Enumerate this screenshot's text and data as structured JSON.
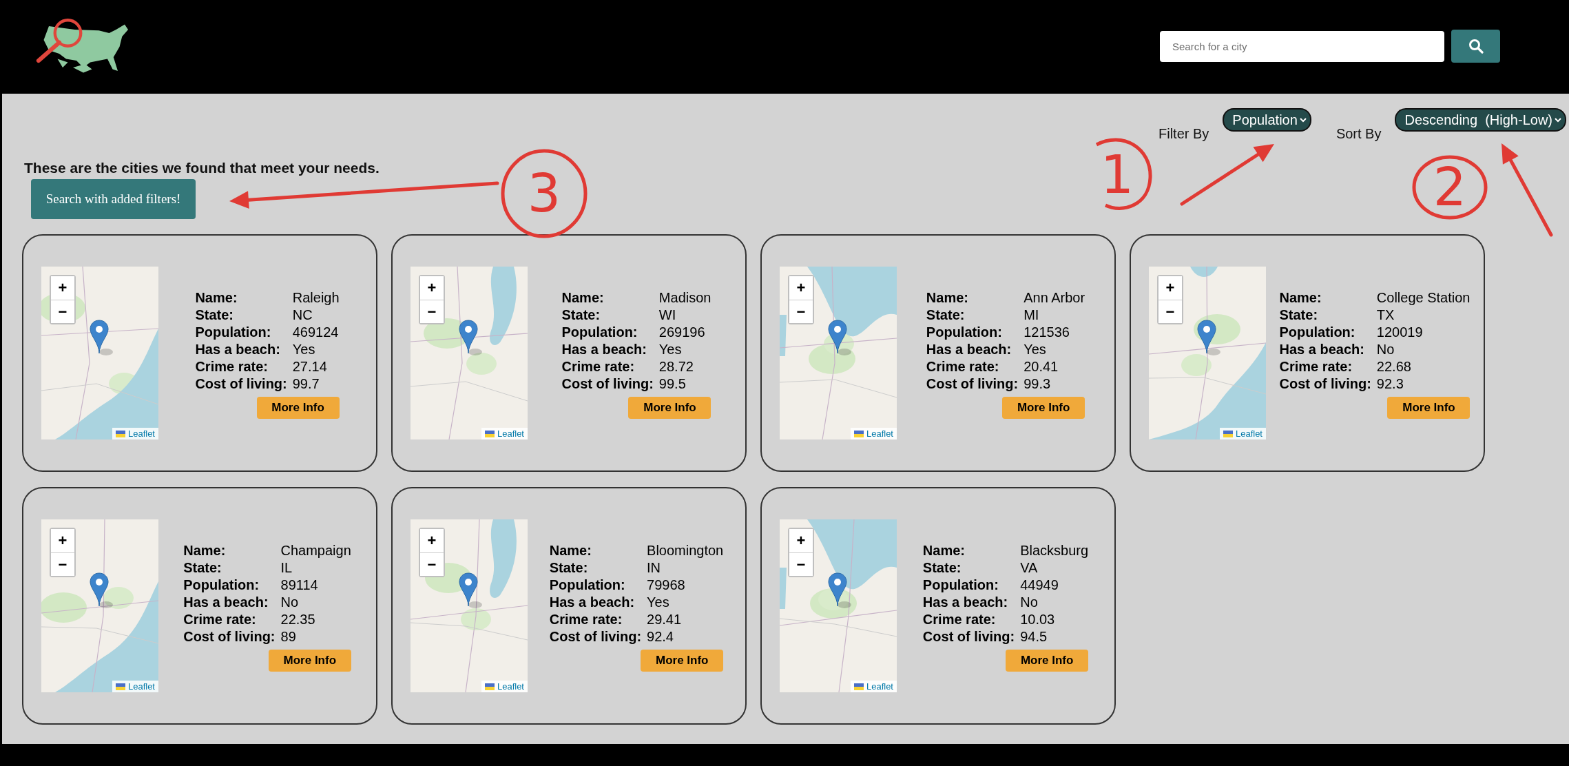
{
  "header": {
    "search": {
      "placeholder": "Search for a city"
    }
  },
  "filter": {
    "label": "Filter By",
    "value": "Population"
  },
  "sort": {
    "label": "Sort By",
    "value": "Descending  (High-Low)"
  },
  "heading": "These are the cities we found that meet your needs.",
  "search_button": "Search with added filters!",
  "cards": [
    {
      "map": {
        "zoom_in": "+",
        "zoom_out": "−",
        "attribution": "Leaflet"
      },
      "fields": [
        {
          "label": "Name:",
          "value": "Raleigh"
        },
        {
          "label": "State:",
          "value": "NC"
        },
        {
          "label": "Population:",
          "value": "469124"
        },
        {
          "label": "Has a beach:",
          "value": "Yes"
        },
        {
          "label": "Crime rate:",
          "value": "27.14"
        },
        {
          "label": "Cost of living:",
          "value": "99.7"
        }
      ],
      "button": "More Info"
    },
    {
      "map": {
        "zoom_in": "+",
        "zoom_out": "−",
        "attribution": "Leaflet"
      },
      "fields": [
        {
          "label": "Name:",
          "value": "Madison"
        },
        {
          "label": "State:",
          "value": "WI"
        },
        {
          "label": "Population:",
          "value": "269196"
        },
        {
          "label": "Has a beach:",
          "value": "Yes"
        },
        {
          "label": "Crime rate:",
          "value": "28.72"
        },
        {
          "label": "Cost of living:",
          "value": "99.5"
        }
      ],
      "button": "More Info"
    },
    {
      "map": {
        "zoom_in": "+",
        "zoom_out": "−",
        "attribution": "Leaflet"
      },
      "fields": [
        {
          "label": "Name:",
          "value": "Ann Arbor"
        },
        {
          "label": "State:",
          "value": "MI"
        },
        {
          "label": "Population:",
          "value": "121536"
        },
        {
          "label": "Has a beach:",
          "value": "Yes"
        },
        {
          "label": "Crime rate:",
          "value": "20.41"
        },
        {
          "label": "Cost of living:",
          "value": "99.3"
        }
      ],
      "button": "More Info"
    },
    {
      "map": {
        "zoom_in": "+",
        "zoom_out": "−",
        "attribution": "Leaflet"
      },
      "fields": [
        {
          "label": "Name:",
          "value": "College Station"
        },
        {
          "label": "State:",
          "value": "TX"
        },
        {
          "label": "Population:",
          "value": "120019"
        },
        {
          "label": "Has a beach:",
          "value": "No"
        },
        {
          "label": "Crime rate:",
          "value": "22.68"
        },
        {
          "label": "Cost of living:",
          "value": "92.3"
        }
      ],
      "button": "More Info"
    },
    {
      "map": {
        "zoom_in": "+",
        "zoom_out": "−",
        "attribution": "Leaflet"
      },
      "fields": [
        {
          "label": "Name:",
          "value": "Champaign"
        },
        {
          "label": "State:",
          "value": "IL"
        },
        {
          "label": "Population:",
          "value": "89114"
        },
        {
          "label": "Has a beach:",
          "value": "No"
        },
        {
          "label": "Crime rate:",
          "value": "22.35"
        },
        {
          "label": "Cost of living:",
          "value": "89"
        }
      ],
      "button": "More Info"
    },
    {
      "map": {
        "zoom_in": "+",
        "zoom_out": "−",
        "attribution": "Leaflet"
      },
      "fields": [
        {
          "label": "Name:",
          "value": "Bloomington"
        },
        {
          "label": "State:",
          "value": "IN"
        },
        {
          "label": "Population:",
          "value": "79968"
        },
        {
          "label": "Has a beach:",
          "value": "Yes"
        },
        {
          "label": "Crime rate:",
          "value": "29.41"
        },
        {
          "label": "Cost of living:",
          "value": "92.4"
        }
      ],
      "button": "More Info"
    },
    {
      "map": {
        "zoom_in": "+",
        "zoom_out": "−",
        "attribution": "Leaflet"
      },
      "fields": [
        {
          "label": "Name:",
          "value": "Blacksburg"
        },
        {
          "label": "State:",
          "value": "VA"
        },
        {
          "label": "Population:",
          "value": "44949"
        },
        {
          "label": "Has a beach:",
          "value": "No"
        },
        {
          "label": "Crime rate:",
          "value": "10.03"
        },
        {
          "label": "Cost of living:",
          "value": "94.5"
        }
      ],
      "button": "More Info"
    }
  ],
  "annotations": [
    {
      "label": "3"
    },
    {
      "label": "1"
    },
    {
      "label": "2"
    }
  ]
}
